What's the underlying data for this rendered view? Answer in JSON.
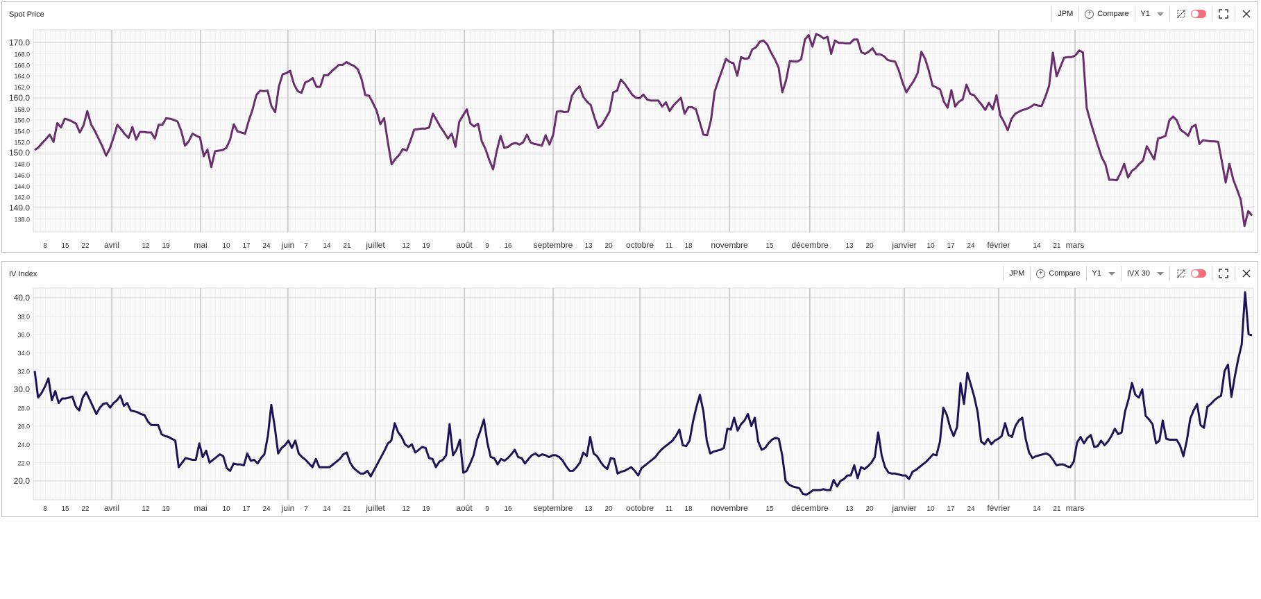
{
  "panels": [
    {
      "title": "Spot Price",
      "toolbar": {
        "ticker": "JPM",
        "compare": "Compare",
        "period": "Y1"
      },
      "icons": [
        "autoscale-off-icon",
        "toggle-switch",
        "fullscreen-icon",
        "close-icon"
      ]
    },
    {
      "title": "IV Index",
      "toolbar": {
        "ticker": "JPM",
        "compare": "Compare",
        "period": "Y1",
        "metric": "IVX 30"
      },
      "icons": [
        "autoscale-off-icon",
        "toggle-switch",
        "fullscreen-icon",
        "close-icon"
      ]
    }
  ],
  "colors": {
    "spot_line": "#6a2e6f",
    "iv_line": "#1c1457",
    "grid": "#d6d6d6",
    "minor_grid": "#ececec"
  },
  "chart_data": [
    {
      "type": "line",
      "title": "Spot Price",
      "ylim": [
        136.4,
        171.6
      ],
      "yticks": [
        "170.0",
        "168.0",
        "166.0",
        "164.0",
        "162.0",
        "160.0",
        "158.0",
        "156.0",
        "154.0",
        "152.0",
        "150.0",
        "148.0",
        "146.0",
        "144.0",
        "142.0",
        "140.0",
        "138.0"
      ],
      "xticks": [
        "8",
        "15",
        "22",
        "avril",
        "12",
        "19",
        "mai",
        "10",
        "17",
        "24",
        "juin",
        "7",
        "14",
        "21",
        "juillet",
        "12",
        "19",
        "août",
        "9",
        "16",
        "septembre",
        "13",
        "20",
        "octobre",
        "11",
        "18",
        "novembre",
        "15",
        "décembre",
        "13",
        "20",
        "janvier",
        "10",
        "17",
        "24",
        "février",
        "14",
        "21",
        "mars"
      ],
      "series": [
        {
          "name": "",
          "values": [
            150.5,
            151.0,
            151.8,
            152.5,
            153.3,
            152.0,
            155.4,
            154.6,
            156.2,
            156.0,
            155.7,
            155.3,
            153.7,
            155.0,
            157.6,
            155.2,
            154.0,
            152.6,
            151.2,
            149.5,
            150.8,
            152.8,
            155.1,
            154.3,
            153.4,
            152.7,
            154.7,
            152.4,
            153.8,
            153.8,
            153.7,
            153.7,
            152.6,
            155.1,
            155.1,
            156.3,
            156.2,
            156.0,
            155.7,
            154.0,
            151.3,
            152.1,
            153.5,
            153.1,
            152.8,
            149.4,
            150.6,
            147.4,
            150.3,
            150.4,
            150.5,
            150.9,
            152.4,
            155.2,
            153.9,
            153.7,
            153.5,
            155.9,
            157.9,
            160.5,
            161.3,
            161.2,
            161.3,
            158.5,
            157.4,
            162.1,
            164.3,
            164.5,
            164.9,
            162.5,
            161.2,
            160.9,
            162.8,
            163.1,
            163.6,
            162.0,
            162.0,
            164.1,
            164.1,
            164.8,
            165.4,
            166.0,
            166.0,
            166.5,
            166.1,
            165.8,
            165.2,
            163.4,
            160.5,
            160.4,
            159.1,
            157.7,
            155.2,
            156.3,
            151.9,
            147.9,
            148.9,
            149.6,
            150.7,
            150.4,
            152.2,
            154.2,
            154.3,
            154.4,
            154.4,
            154.6,
            157.1,
            155.9,
            154.7,
            153.7,
            152.6,
            153.5,
            151.1,
            155.6,
            156.8,
            157.9,
            155.3,
            154.8,
            155.3,
            152.1,
            150.7,
            148.7,
            147.0,
            150.4,
            153.1,
            150.9,
            151.1,
            151.6,
            151.8,
            151.5,
            151.9,
            153.3,
            151.9,
            151.6,
            151.5,
            151.3,
            153.2,
            151.5,
            153.3,
            157.5,
            157.6,
            157.4,
            157.5,
            160.4,
            161.4,
            162.1,
            160.2,
            159.3,
            158.7,
            156.4,
            154.5,
            155.1,
            156.3,
            157.5,
            161.0,
            161.3,
            163.3,
            162.6,
            161.6,
            160.6,
            160.0,
            159.9,
            160.6,
            159.7,
            159.5,
            159.5,
            159.5,
            158.4,
            159.2,
            157.6,
            158.6,
            159.3,
            160.0,
            157.1,
            158.3,
            158.3,
            157.9,
            155.6,
            153.3,
            153.2,
            155.9,
            161.2,
            163.2,
            165.1,
            167.1,
            166.5,
            166.3,
            164.0,
            167.4,
            167.1,
            167.2,
            168.8,
            169.2,
            170.2,
            170.4,
            169.7,
            168.2,
            167.0,
            165.5,
            161.0,
            163.2,
            166.7,
            166.6,
            166.6,
            167.0,
            170.6,
            171.4,
            169.3,
            171.6,
            171.3,
            170.8,
            171.1,
            168.0,
            170.4,
            170.0,
            170.0,
            169.9,
            169.9,
            170.6,
            170.6,
            168.3,
            168.0,
            168.4,
            169.0,
            167.9,
            167.9,
            167.6,
            166.9,
            166.7,
            166.6,
            165.0,
            162.8,
            161.0,
            162.1,
            163.1,
            164.5,
            168.4,
            167.1,
            164.9,
            162.2,
            161.9,
            161.5,
            159.3,
            158.2,
            161.4,
            158.4,
            159.3,
            159.7,
            162.4,
            160.7,
            160.5,
            159.6,
            158.8,
            157.8,
            159.1,
            157.9,
            160.5,
            156.8,
            155.6,
            154.1,
            156.2,
            157.1,
            157.5,
            157.8,
            158.0,
            158.3,
            158.8,
            158.6,
            158.5,
            160.2,
            162.2,
            168.2,
            163.9,
            165.6,
            167.3,
            167.4,
            167.4,
            167.7,
            168.6,
            168.3,
            158.2,
            155.7,
            153.5,
            151.3,
            149.2,
            147.9,
            145.1,
            145.1,
            145.0,
            146.3,
            148.0,
            145.5,
            146.7,
            147.2,
            148.0,
            148.6,
            151.2,
            150.0,
            148.8,
            152.6,
            152.8,
            153.1,
            155.9,
            156.6,
            155.9,
            154.2,
            153.7,
            153.1,
            154.7,
            155.1,
            151.6,
            152.3,
            152.2,
            152.1,
            152.1,
            152.0,
            148.4,
            144.6,
            148.0,
            145.2,
            143.4,
            141.5,
            136.7,
            139.4,
            138.6
          ]
        }
      ]
    },
    {
      "type": "line",
      "title": "IV Index",
      "ylim": [
        18.4,
        40.6
      ],
      "yticks": [
        "40.0",
        "38.0",
        "36.0",
        "34.0",
        "32.0",
        "30.0",
        "28.0",
        "26.0",
        "24.0",
        "22.0",
        "20.0"
      ],
      "xticks": [
        "8",
        "15",
        "22",
        "avril",
        "12",
        "19",
        "mai",
        "10",
        "17",
        "24",
        "juin",
        "7",
        "14",
        "21",
        "juillet",
        "12",
        "19",
        "août",
        "9",
        "16",
        "septembre",
        "13",
        "20",
        "octobre",
        "11",
        "18",
        "novembre",
        "15",
        "décembre",
        "13",
        "20",
        "janvier",
        "10",
        "17",
        "24",
        "février",
        "14",
        "21",
        "mars"
      ],
      "series": [
        {
          "name": "",
          "values": [
            32.0,
            29.1,
            29.6,
            30.3,
            31.2,
            28.8,
            29.8,
            28.5,
            29.0,
            29.0,
            29.1,
            29.2,
            28.1,
            27.7,
            29.1,
            29.7,
            28.9,
            28.1,
            27.3,
            28.0,
            28.4,
            28.5,
            28.0,
            28.5,
            28.8,
            29.3,
            28.2,
            28.5,
            27.7,
            27.6,
            27.5,
            27.3,
            27.2,
            26.5,
            26.1,
            26.1,
            26.1,
            25.1,
            24.9,
            24.8,
            24.6,
            24.4,
            21.5,
            22.0,
            22.5,
            22.4,
            22.3,
            22.3,
            24.1,
            22.6,
            23.3,
            22.0,
            22.3,
            22.6,
            22.9,
            22.7,
            21.4,
            21.1,
            21.9,
            21.8,
            21.8,
            21.7,
            23.0,
            22.2,
            22.3,
            21.9,
            22.5,
            22.9,
            24.9,
            28.3,
            25.9,
            23.0,
            23.6,
            23.9,
            24.4,
            23.6,
            24.4,
            23.0,
            22.6,
            22.3,
            21.9,
            21.5,
            22.4,
            21.5,
            21.5,
            21.5,
            21.5,
            21.8,
            22.1,
            22.4,
            22.9,
            23.1,
            22.0,
            21.4,
            21.1,
            20.8,
            20.8,
            21.1,
            20.5,
            21.2,
            21.9,
            22.6,
            23.3,
            24.1,
            24.4,
            26.3,
            25.3,
            24.8,
            24.0,
            23.7,
            24.0,
            23.1,
            23.4,
            23.7,
            23.6,
            22.5,
            22.4,
            21.5,
            22.1,
            22.3,
            22.8,
            26.2,
            22.8,
            23.4,
            24.5,
            20.9,
            21.1,
            21.9,
            22.8,
            24.5,
            25.5,
            26.7,
            24.2,
            22.6,
            22.5,
            21.8,
            22.4,
            22.2,
            22.5,
            22.9,
            23.4,
            22.6,
            22.5,
            21.9,
            22.4,
            22.8,
            23.0,
            22.7,
            22.9,
            22.8,
            22.6,
            22.8,
            22.8,
            22.6,
            22.2,
            21.6,
            21.1,
            21.1,
            21.5,
            22.0,
            23.1,
            22.7,
            24.8,
            23.0,
            22.7,
            22.1,
            21.6,
            21.3,
            22.5,
            22.4,
            20.8,
            21.0,
            21.1,
            21.3,
            21.5,
            21.1,
            20.6,
            21.4,
            21.7,
            22.0,
            22.3,
            22.6,
            23.1,
            23.5,
            23.8,
            24.1,
            24.4,
            24.9,
            25.6,
            23.9,
            23.8,
            24.4,
            26.5,
            28.1,
            29.4,
            27.6,
            24.4,
            23.0,
            23.2,
            23.3,
            23.4,
            23.6,
            25.7,
            25.6,
            26.9,
            25.5,
            26.2,
            26.6,
            27.3,
            26.0,
            26.9,
            24.3,
            23.4,
            23.6,
            24.1,
            24.5,
            24.7,
            24.6,
            22.8,
            20.0,
            19.6,
            19.4,
            19.3,
            19.2,
            18.6,
            18.5,
            18.7,
            19.0,
            19.0,
            19.0,
            19.1,
            19.0,
            19.0,
            20.1,
            19.4,
            20.0,
            20.2,
            20.6,
            20.6,
            21.7,
            20.3,
            21.5,
            21.3,
            21.6,
            22.0,
            22.6,
            25.3,
            22.8,
            21.5,
            20.9,
            20.8,
            20.8,
            20.7,
            20.6,
            20.6,
            20.2,
            21.0,
            21.2,
            21.5,
            21.8,
            22.1,
            22.5,
            22.9,
            22.8,
            24.3,
            28.0,
            27.2,
            25.8,
            24.9,
            25.9,
            30.7,
            28.4,
            31.8,
            30.5,
            29.2,
            27.5,
            24.3,
            24.0,
            24.6,
            24.0,
            24.4,
            24.6,
            24.9,
            26.3,
            25.0,
            24.8,
            26.0,
            26.6,
            26.9,
            24.6,
            23.1,
            22.5,
            22.7,
            22.8,
            22.9,
            23.0,
            22.8,
            22.3,
            21.7,
            21.8,
            21.8,
            21.6,
            21.5,
            22.1,
            24.2,
            24.8,
            24.1,
            24.7,
            25.0,
            23.7,
            23.8,
            24.4,
            23.9,
            24.3,
            24.9,
            25.7,
            25.1,
            25.3,
            27.6,
            28.9,
            30.7,
            29.4,
            29.1,
            30.0,
            27.1,
            26.7,
            26.2,
            24.1,
            24.4,
            26.6,
            24.6,
            24.5,
            24.5,
            24.5,
            23.9,
            22.7,
            24.4,
            26.8,
            27.7,
            28.4,
            26.1,
            25.8,
            28.1,
            28.4,
            28.8,
            29.1,
            29.3,
            32.0,
            32.7,
            29.2,
            31.4,
            33.3,
            34.9,
            40.6,
            36.0,
            35.9
          ]
        }
      ]
    }
  ]
}
